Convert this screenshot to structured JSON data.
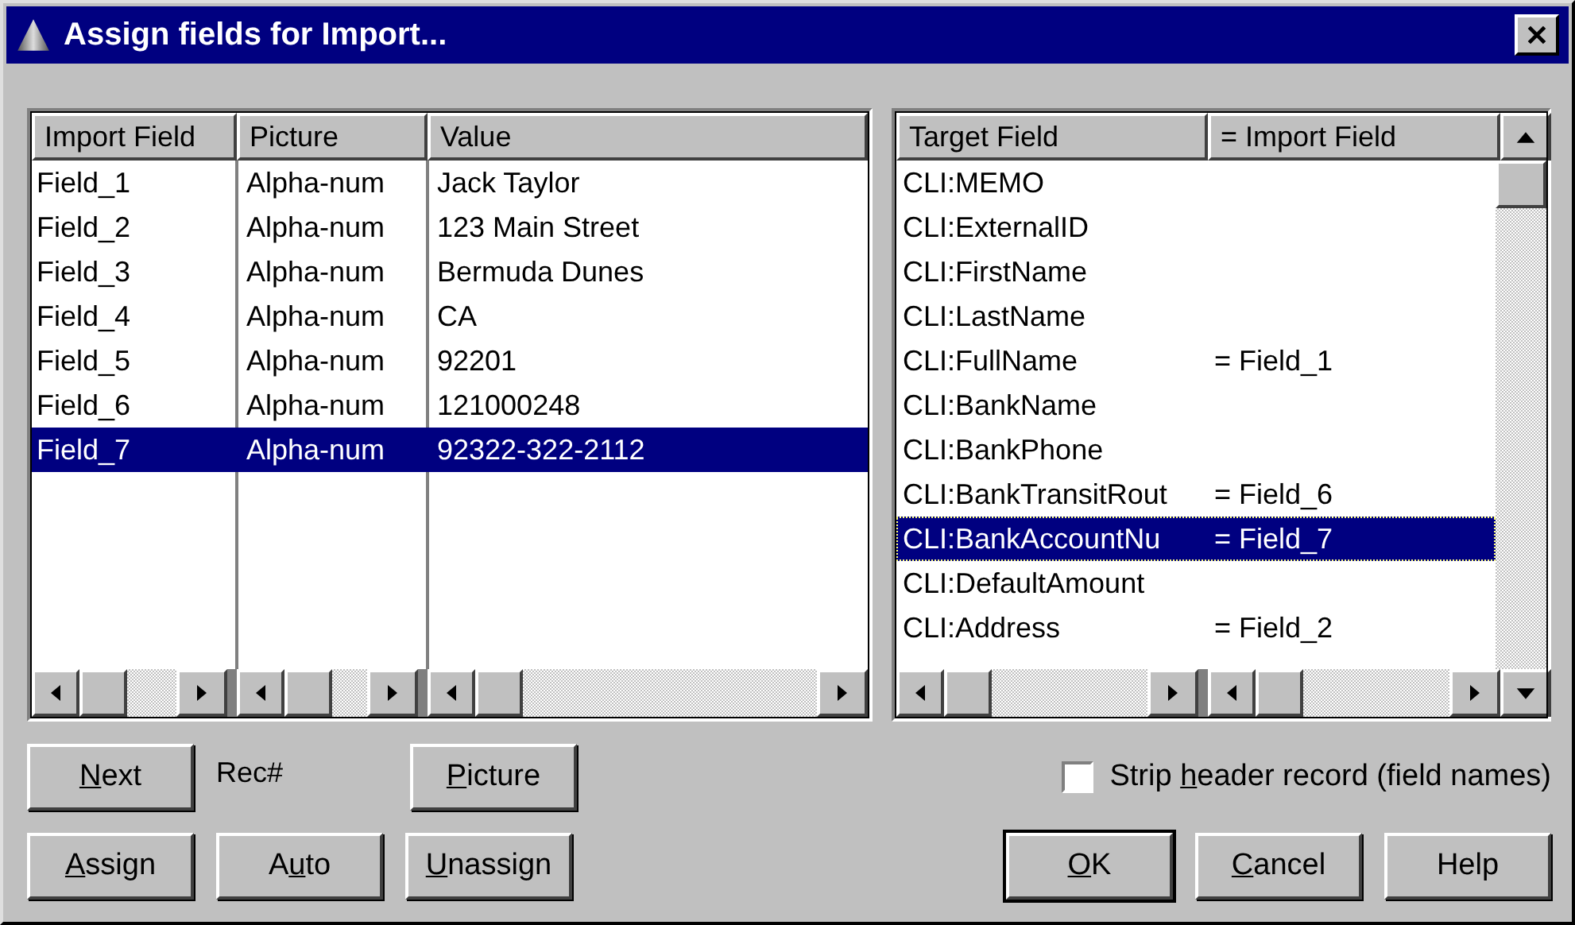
{
  "window": {
    "title": "Assign fields for Import..."
  },
  "import_list": {
    "columns": [
      "Import Field",
      "Picture",
      "Value"
    ],
    "rows": [
      {
        "cells": [
          "Field_1",
          "Alpha-num",
          "Jack Taylor"
        ],
        "selected": false
      },
      {
        "cells": [
          "Field_2",
          "Alpha-num",
          "123 Main Street"
        ],
        "selected": false
      },
      {
        "cells": [
          "Field_3",
          "Alpha-num",
          "Bermuda Dunes"
        ],
        "selected": false
      },
      {
        "cells": [
          "Field_4",
          "Alpha-num",
          "CA"
        ],
        "selected": false
      },
      {
        "cells": [
          "Field_5",
          "Alpha-num",
          "92201"
        ],
        "selected": false
      },
      {
        "cells": [
          "Field_6",
          "Alpha-num",
          "121000248"
        ],
        "selected": false
      },
      {
        "cells": [
          "Field_7",
          "Alpha-num",
          "92322-322-2112"
        ],
        "selected": true
      }
    ]
  },
  "target_list": {
    "columns": [
      "Target Field",
      "= Import Field"
    ],
    "rows": [
      {
        "target": "CLI:MEMO",
        "selected": false
      },
      {
        "target": "CLI:ExternalID",
        "selected": false
      },
      {
        "target": "CLI:FirstName",
        "selected": false
      },
      {
        "target": "CLI:LastName",
        "selected": false
      },
      {
        "target": "CLI:FullName",
        "import_field": "= Field_1",
        "selected": false
      },
      {
        "target": "CLI:BankName",
        "selected": false
      },
      {
        "target": "CLI:BankPhone",
        "selected": false
      },
      {
        "target": "CLI:BankTransitRout",
        "import_field": "= Field_6",
        "selected": false
      },
      {
        "target": "CLI:BankAccountNu",
        "import_field": "= Field_7",
        "selected": true
      },
      {
        "target": "CLI:DefaultAmount",
        "selected": false
      },
      {
        "target": "CLI:Address",
        "import_field": "= Field_2",
        "selected": false
      }
    ]
  },
  "record_buttons": [
    {
      "label": {
        "key": "N",
        "post": "ext"
      }
    },
    {
      "label": {
        "key": "P",
        "post": "icture"
      }
    }
  ],
  "rec_label": "Rec#",
  "assign_buttons": [
    {
      "label": {
        "key": "A",
        "post": "ssign"
      }
    },
    {
      "label": {
        "pre": "A",
        "key": "u",
        "post": "to"
      }
    },
    {
      "label": {
        "key": "U",
        "post": "nassign"
      }
    }
  ],
  "strip_header": {
    "label": {
      "pre": "Strip ",
      "key": "h",
      "post": "eader record (field names)"
    },
    "checked": false
  },
  "dialog_buttons": [
    {
      "label": {
        "key": "O",
        "post": "K"
      },
      "default": true
    },
    {
      "label": {
        "key": "C",
        "post": "ancel"
      },
      "default": false
    },
    {
      "label": {
        "pre": "Help"
      },
      "default": false
    }
  ]
}
